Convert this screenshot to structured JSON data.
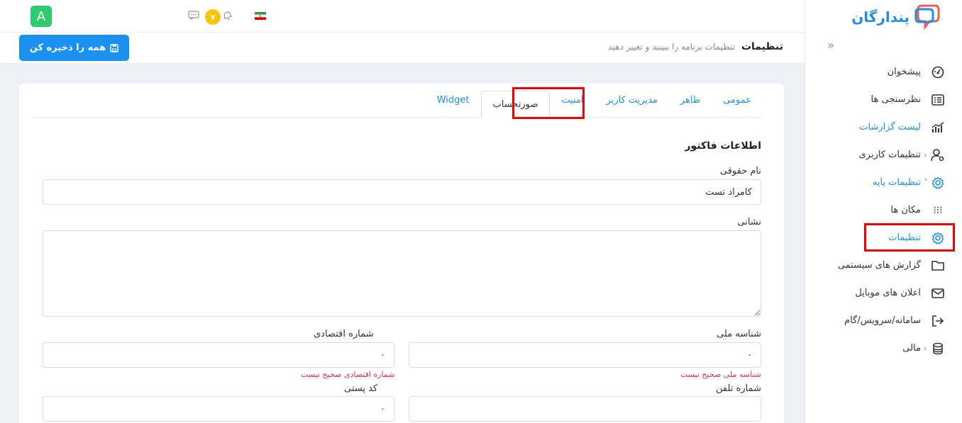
{
  "brand": {
    "name": "پندارگان"
  },
  "topbar": {
    "avatar_letter": "A",
    "notification_count": "۷"
  },
  "page": {
    "title": "تنظیمات",
    "subtitle": "تنظیمات برنامه را ببینید و تغییر دهید",
    "save_all_label": "همه را ذخیره کن"
  },
  "sidebar": {
    "items": [
      {
        "label": "پیشخوان",
        "icon": "dashboard-icon"
      },
      {
        "label": "نظرسنجی ها",
        "icon": "survey-list-icon"
      },
      {
        "label": "لیست گزارشات",
        "icon": "report-chart-icon"
      },
      {
        "label": "تنظیمات کاربری",
        "icon": "user-settings-icon"
      },
      {
        "label": "تنظیمات پایه",
        "icon": "gear-icon"
      },
      {
        "label": "مکان ها",
        "icon": "dots-icon"
      },
      {
        "label": "تنظیمات",
        "icon": "gear-icon"
      },
      {
        "label": "گزارش های سیستمی",
        "icon": "folder-icon"
      },
      {
        "label": "اعلان های موبایل",
        "icon": "mail-icon"
      },
      {
        "label": "سامانه/سرویس/گام",
        "icon": "login-icon"
      },
      {
        "label": "مالی",
        "icon": "coins-icon"
      }
    ]
  },
  "tabs": [
    "عمومی",
    "ظاهر",
    "مدیریت کاربر",
    "امنیت",
    "صورتحساب",
    "Widget"
  ],
  "form": {
    "section_title": "اطلاعات فاکتور",
    "legal_name_label": "نام حقوقی",
    "legal_name_value": "کامراد تست",
    "address_label": "نشانی",
    "national_id_label": "شناسه ملی",
    "national_id_value": "۰",
    "national_id_error": "شناسه ملی صحیح نیست",
    "economic_code_label": "شماره اقتصادی",
    "economic_code_value": "۰",
    "economic_code_error": "شماره اقتصادی صحیح نیست",
    "phone_label": "شماره تلفن",
    "phone_value": "",
    "postal_code_label": "کد پستی",
    "postal_code_value": "۰"
  },
  "colors": {
    "accent": "#1f8ee6",
    "error": "#e0305a",
    "highlight": "#ee0000",
    "avatar": "#2ecc71",
    "badge": "#f7c600"
  }
}
